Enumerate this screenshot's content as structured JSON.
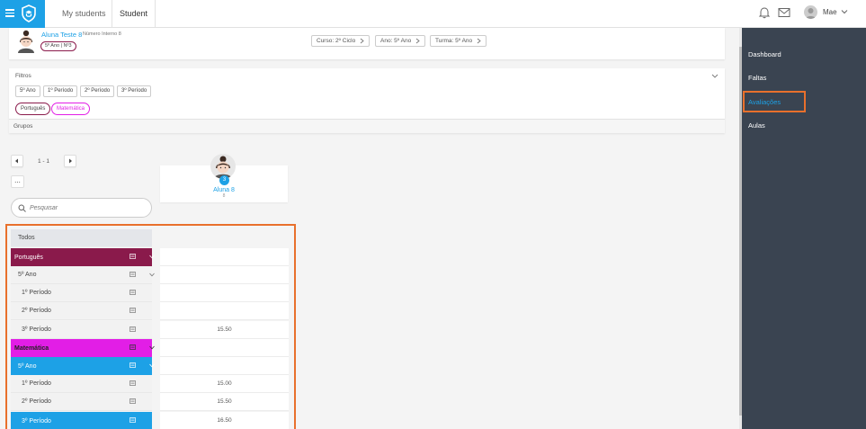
{
  "topbar": {
    "tabs": [
      "My students",
      "Student"
    ],
    "user_name": "Mae"
  },
  "sidebar": {
    "items": [
      {
        "label": "Dashboard",
        "active": false
      },
      {
        "label": "Faltas",
        "active": false
      },
      {
        "label": "Avaliações",
        "active": true
      },
      {
        "label": "Aulas",
        "active": false
      }
    ]
  },
  "student": {
    "name": "Aluna Teste 8",
    "number_label": "Número Interno 8",
    "badge": "5º Ano | Nº3",
    "chips": [
      "Curso: 2º Ciclo",
      "Ano: 5º Ano",
      "Turma: 5º Ano"
    ]
  },
  "filters": {
    "title": "Filtros",
    "buttons": [
      "5º Ano",
      "1º Período",
      "2º Período",
      "3º Período"
    ],
    "subjects": [
      {
        "label": "Português",
        "color": "#8a1a4b"
      },
      {
        "label": "Matemática",
        "color": "#e21ee6"
      }
    ],
    "groups_label": "Grupos"
  },
  "pagination": {
    "label": "1 - 1",
    "more": "..."
  },
  "column": {
    "name": "Aluna 8",
    "sub": "8",
    "badge": "3"
  },
  "search": {
    "placeholder": "Pesquisar"
  },
  "table": {
    "rows": [
      {
        "label": "Todos",
        "value": ""
      },
      {
        "label": "Português",
        "value": ""
      },
      {
        "label": "5º Ano",
        "value": ""
      },
      {
        "label": "1º Período",
        "value": ""
      },
      {
        "label": "2º Período",
        "value": ""
      },
      {
        "label": "3º Período",
        "value": "15.50"
      },
      {
        "label": "Matemática",
        "value": ""
      },
      {
        "label": "5º Ano",
        "value": ""
      },
      {
        "label": "1º Período",
        "value": "15.00"
      },
      {
        "label": "2º Período",
        "value": "15.50"
      },
      {
        "label": "3º Período",
        "value": "16.50"
      }
    ]
  },
  "colors": {
    "accent": "#1da1e6",
    "portugues": "#8a1a4b",
    "matematica": "#e21ee6",
    "highlight": "#e8702c",
    "sidebar": "#3a4451"
  }
}
